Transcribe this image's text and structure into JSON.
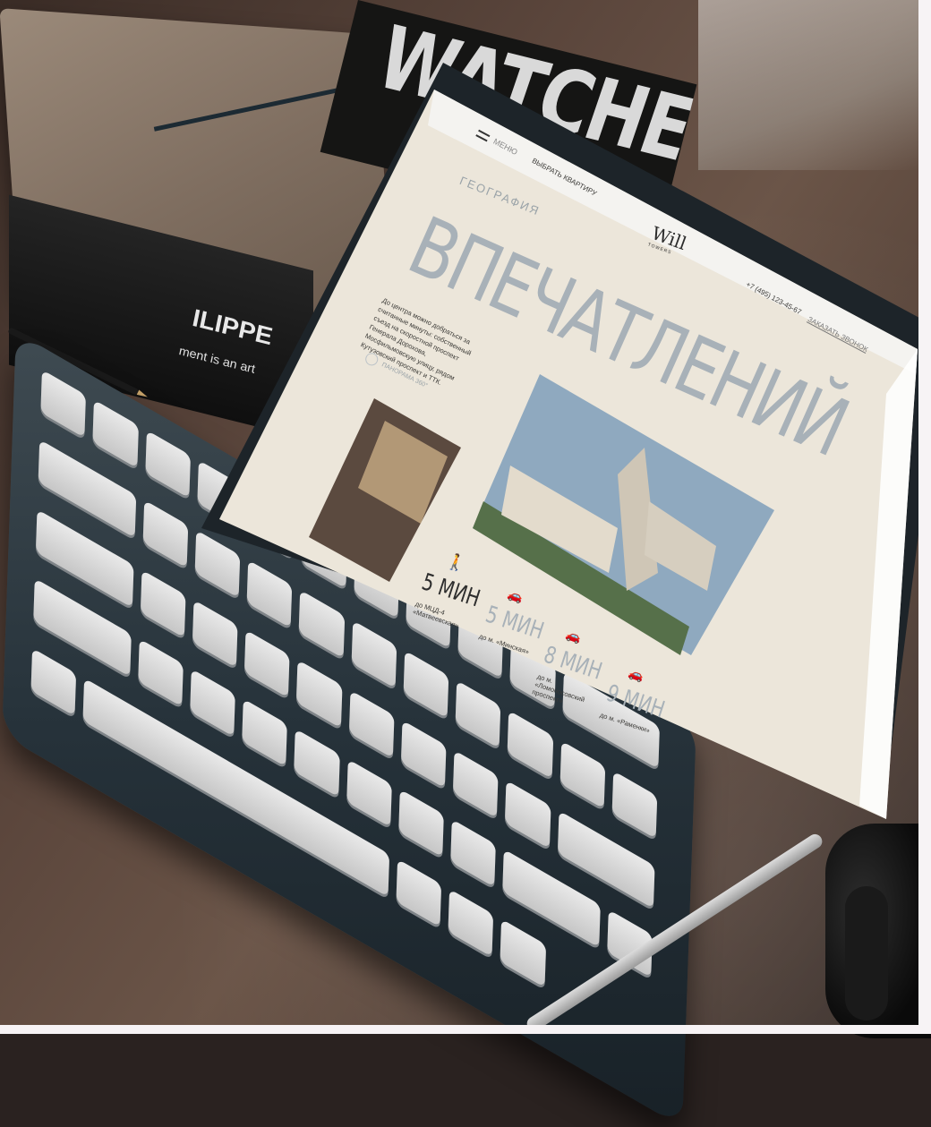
{
  "scene": {
    "magazine_title": "WATCHES",
    "book_title": "ILIPPE",
    "book_subtitle": "ment is an art"
  },
  "site": {
    "menu_label": "МЕНЮ",
    "nav_select": "ВЫБРАТЬ КВАРТИРУ",
    "logo_main": "Will",
    "logo_sub": "TOWERS",
    "phone": "+7 (495) 123-45-67",
    "callback": "ЗАКАЗАТЬ ЗВОНОК",
    "section_label": "ГЕОГРАФИЯ",
    "headline": "ВПЕЧАТЛЕНИЙ",
    "description": "До центра можно добраться за считанные минуты: собственный съезд на скоростной проспект Генерала Дорохова, Мосфильмовскую улицу, рядом Кутузовский проспект и ТТК.",
    "panorama": "ПАНОРАМА 360°",
    "stats": [
      {
        "icon": "walking-person-icon",
        "time": "5 МИН",
        "dest": "до МЦД-4 «Матвеевская»"
      },
      {
        "icon": "car-icon",
        "time": "5 МИН",
        "dest": "до м. «Минская»"
      },
      {
        "icon": "car-icon",
        "time": "8 МИН",
        "dest": "до м. «Ломоносовский проспект»"
      },
      {
        "icon": "car-icon",
        "time": "9 МИН",
        "dest": "до м. «Раменки»"
      }
    ]
  },
  "colors": {
    "page_bg": "#ece6da",
    "header_bg": "#f4f3f0",
    "headline": "#a8b1b8",
    "text": "#3b3a37"
  }
}
